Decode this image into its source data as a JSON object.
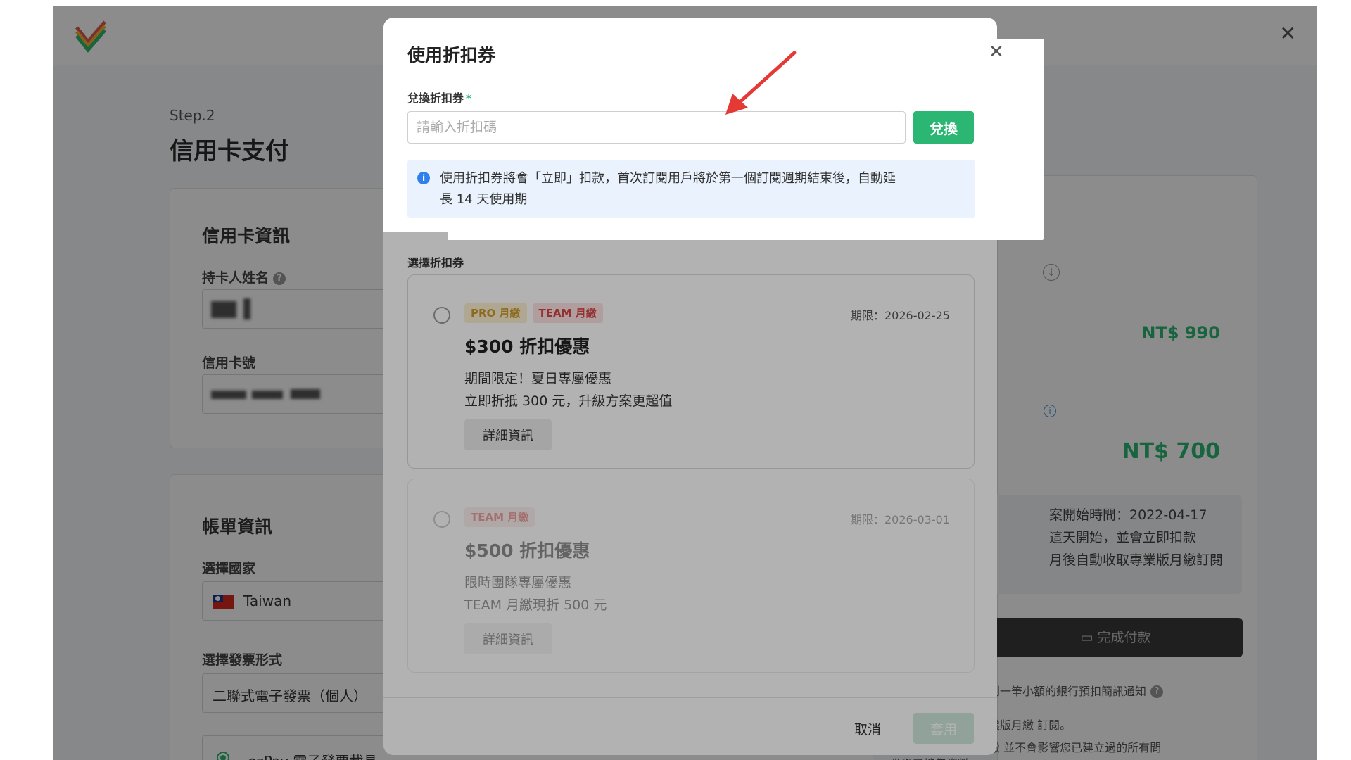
{
  "background": {
    "step_label": "Step.2",
    "page_title": "信用卡支付",
    "credit_card": {
      "section_title": "信用卡資訊",
      "holder_label": "持卡人姓名",
      "number_label": "信用卡號"
    },
    "billing": {
      "section_title": "帳單資訊",
      "country_label": "選擇國家",
      "country_value": "Taiwan",
      "invoice_label": "選擇發票形式",
      "invoice_value": "二聯式電子發票（個人）",
      "carrier_value": "ezPay 電子發票載具"
    },
    "summary": {
      "price_original": "NT$ 990",
      "price_final": "NT$ 700",
      "note_line1": "案開始時間：2022-04-17",
      "note_line2": "這天開始，並會立即扣款",
      "note_line3": "月後自動收取專業版月繳訂閱",
      "pay_button": "完成付款",
      "fine1": "到一筆小額的銀行預扣簡訊通知",
      "fine2": "業版月繳 訂閱。",
      "fine3": "繳 並不會影響您已建立過的所有問",
      "fine4": "卷與已搜集資料。"
    }
  },
  "modal": {
    "title": "使用折扣券",
    "redeem_label": "兌換折扣券",
    "required_mark": "*",
    "code_placeholder": "請輸入折扣碼",
    "redeem_button": "兌換",
    "notice_line1": "使用折扣券將會「立即」扣款，首次訂閱用戶將於第一個訂閱週期結束後，自動延",
    "notice_line2": "長 14 天使用期",
    "select_label": "選擇折扣券",
    "coupons": [
      {
        "tags": [
          "PRO 月繳",
          "TEAM 月繳"
        ],
        "expiry": "期限：2026-02-25",
        "title": "$300 折扣優惠",
        "desc1": "期間限定！夏日專屬優惠",
        "desc2": "立即折抵 300 元，升級方案更超值",
        "detail_button": "詳細資訊"
      },
      {
        "tags": [
          "TEAM 月繳"
        ],
        "expiry": "期限：2026-03-01",
        "title": "$500 折扣優惠",
        "desc1": "限時團隊專屬優惠",
        "desc2": "TEAM 月繳現折 500 元",
        "detail_button": "詳細資訊"
      }
    ],
    "cancel_button": "取消",
    "apply_button": "套用"
  },
  "colors": {
    "accent_green": "#2bb673",
    "annotation_red": "#e53935",
    "info_blue": "#2f80ed"
  }
}
